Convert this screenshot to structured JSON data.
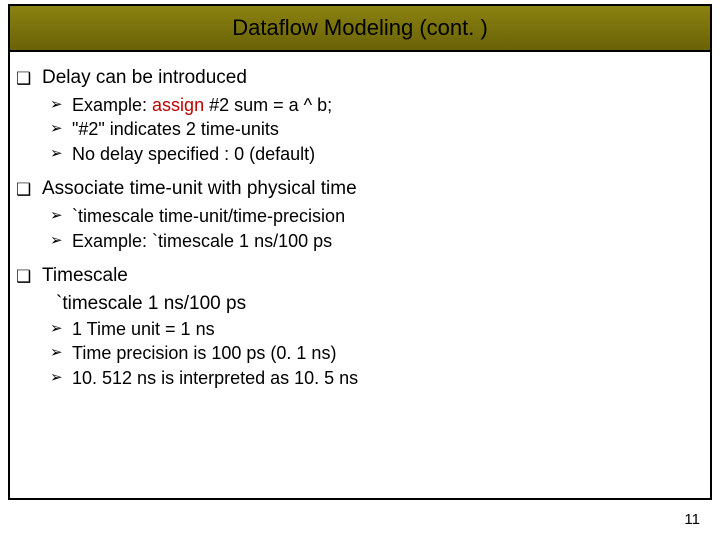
{
  "title": "Dataflow Modeling (cont. )",
  "sections": [
    {
      "heading": "Delay can be introduced",
      "subs": [
        {
          "pre": "Example: ",
          "kw": "assign",
          "post": " #2 sum = a ^ b;"
        },
        {
          "pre": " \"#2\" indicates 2 time-units",
          "kw": "",
          "post": ""
        },
        {
          "pre": "No delay specified : 0 (default)",
          "kw": "",
          "post": ""
        }
      ]
    },
    {
      "heading": "Associate time-unit with physical time",
      "subs": [
        {
          "pre": "`timescale  time-unit/time-precision",
          "kw": "",
          "post": ""
        },
        {
          "pre": "Example: `timescale 1 ns/100 ps",
          "kw": "",
          "post": ""
        }
      ]
    },
    {
      "heading": "Timescale",
      "line": "`timescale 1 ns/100 ps",
      "subs": [
        {
          "pre": "1 Time unit = 1 ns",
          "kw": "",
          "post": ""
        },
        {
          "pre": "Time precision is 100 ps (0. 1 ns)",
          "kw": "",
          "post": ""
        },
        {
          "pre": "10. 512 ns is interpreted as 10. 5 ns",
          "kw": "",
          "post": ""
        }
      ]
    }
  ],
  "page_number": "11"
}
